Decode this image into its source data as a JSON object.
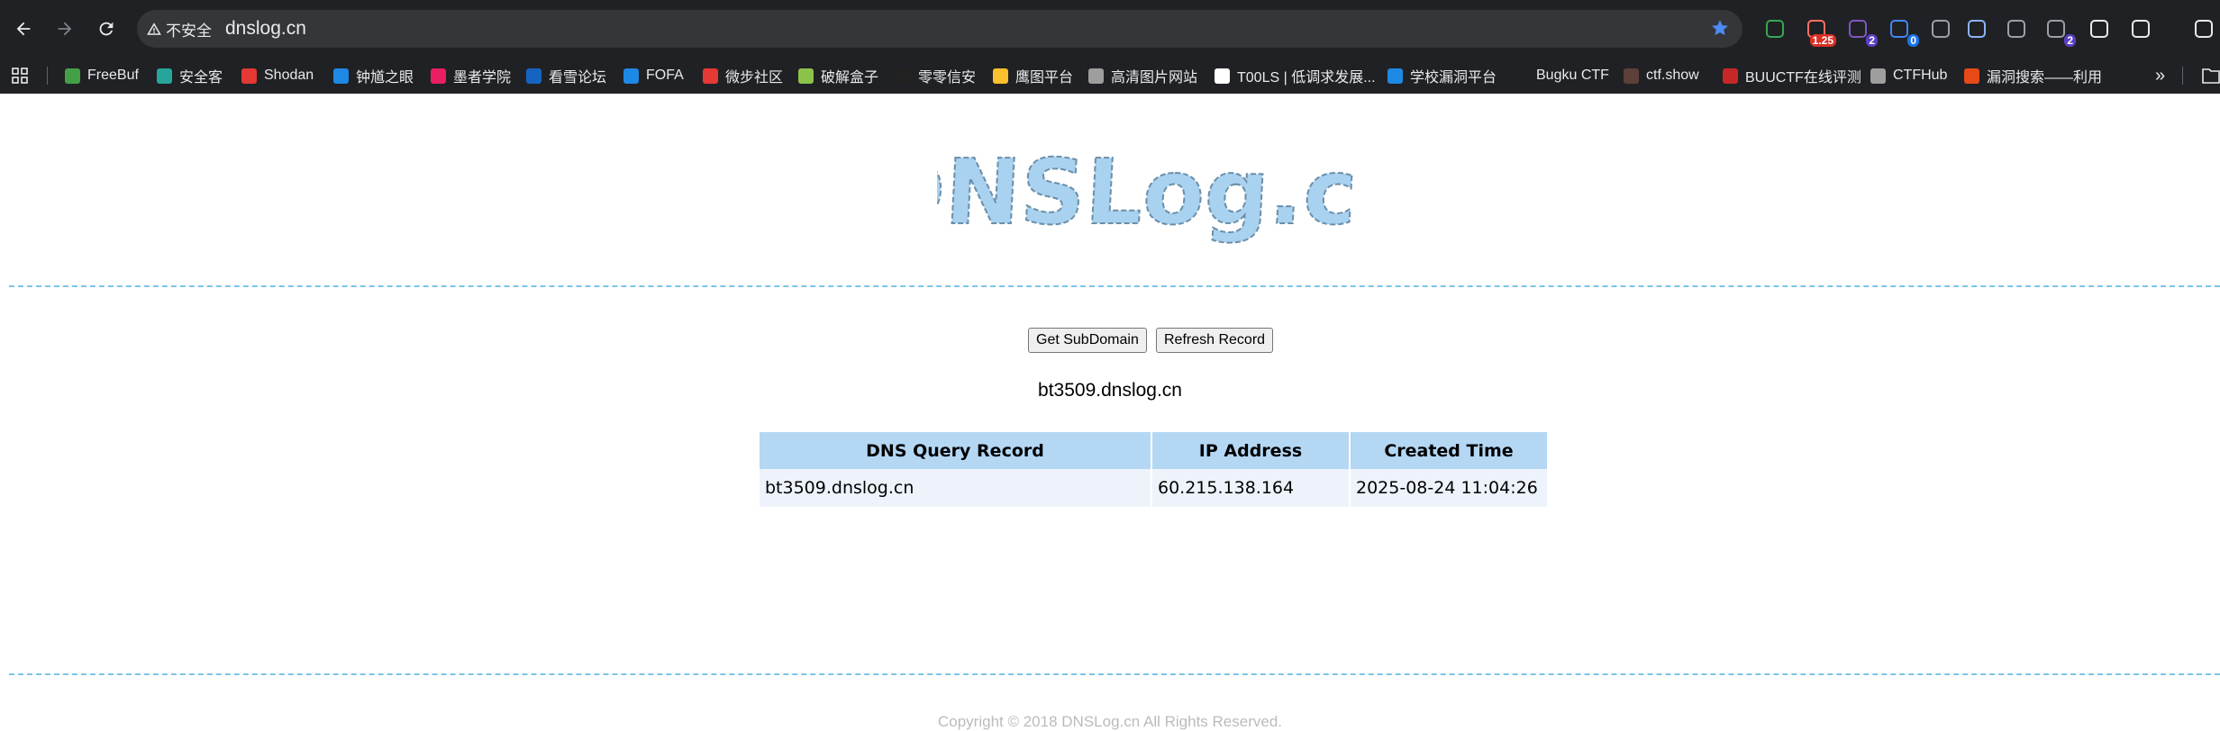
{
  "browser": {
    "security_label": "不安全",
    "url": "dnslog.cn",
    "extensions": [
      {
        "icon": "shield-check-extension-icon",
        "badge": ""
      },
      {
        "icon": "video-speed-extension-icon",
        "badge": "1.25"
      },
      {
        "icon": "hack-bar-extension-icon",
        "badge": "2"
      },
      {
        "icon": "cookie-extension-icon",
        "badge": "0"
      },
      {
        "icon": "wappalyzer-extension-icon",
        "badge": ""
      },
      {
        "icon": "proxy-extension-icon",
        "badge": ""
      },
      {
        "icon": "glasses-extension-icon",
        "badge": ""
      },
      {
        "icon": "user-agent-extension-icon",
        "badge": "2"
      },
      {
        "icon": "chatgpt-extension-icon",
        "badge": ""
      },
      {
        "icon": "puzzle-extensions-icon",
        "badge": ""
      },
      {
        "icon": "reading-list-icon",
        "badge": ""
      }
    ],
    "bookmarks": [
      {
        "label": "FreeBuf",
        "color": "#43a047"
      },
      {
        "label": "安全客",
        "color": "#26a69a"
      },
      {
        "label": "Shodan",
        "color": "#e53935"
      },
      {
        "label": "钟馗之眼",
        "color": "#1e88e5"
      },
      {
        "label": "墨者学院",
        "color": "#e91e63"
      },
      {
        "label": "看雪论坛",
        "color": "#1565c0"
      },
      {
        "label": "FOFA",
        "color": "#1e88e5"
      },
      {
        "label": "微步社区",
        "color": "#e53935"
      },
      {
        "label": "破解盒子",
        "color": "#8bc34a"
      },
      {
        "label": "零零信安",
        "color": "#222222"
      },
      {
        "label": "鹰图平台",
        "color": "#fbc02d"
      },
      {
        "label": "高清图片网站",
        "color": "#9e9e9e"
      },
      {
        "label": "T00LS | 低调求发展...",
        "color": "#ffffff"
      },
      {
        "label": "学校漏洞平台",
        "color": "#1e88e5"
      },
      {
        "label": "Bugku CTF",
        "color": "#202124"
      },
      {
        "label": "ctf.show",
        "color": "#5d4037"
      },
      {
        "label": "BUUCTF在线评测",
        "color": "#c62828"
      },
      {
        "label": "CTFHub",
        "color": "#9e9e9e"
      },
      {
        "label": "漏洞搜索——利用",
        "color": "#e64a19"
      }
    ]
  },
  "page": {
    "logo_text": "DNSLog.cn",
    "buttons": {
      "get_subdomain": "Get SubDomain",
      "refresh_record": "Refresh Record"
    },
    "subdomain": "bt3509.dnslog.cn",
    "table": {
      "headers": [
        "DNS Query Record",
        "IP Address",
        "Created Time"
      ],
      "rows": [
        [
          "bt3509.dnslog.cn",
          "60.215.138.164",
          "2025-08-24 11:04:26"
        ]
      ]
    },
    "copyright": "Copyright © 2018 DNSLog.cn All Rights Reserved."
  },
  "colors": {
    "accent_blue": "#b4d7f4",
    "row_bg": "#eef3fb",
    "divider": "#7ec4e8",
    "logo_fill": "#a9d1f0"
  }
}
